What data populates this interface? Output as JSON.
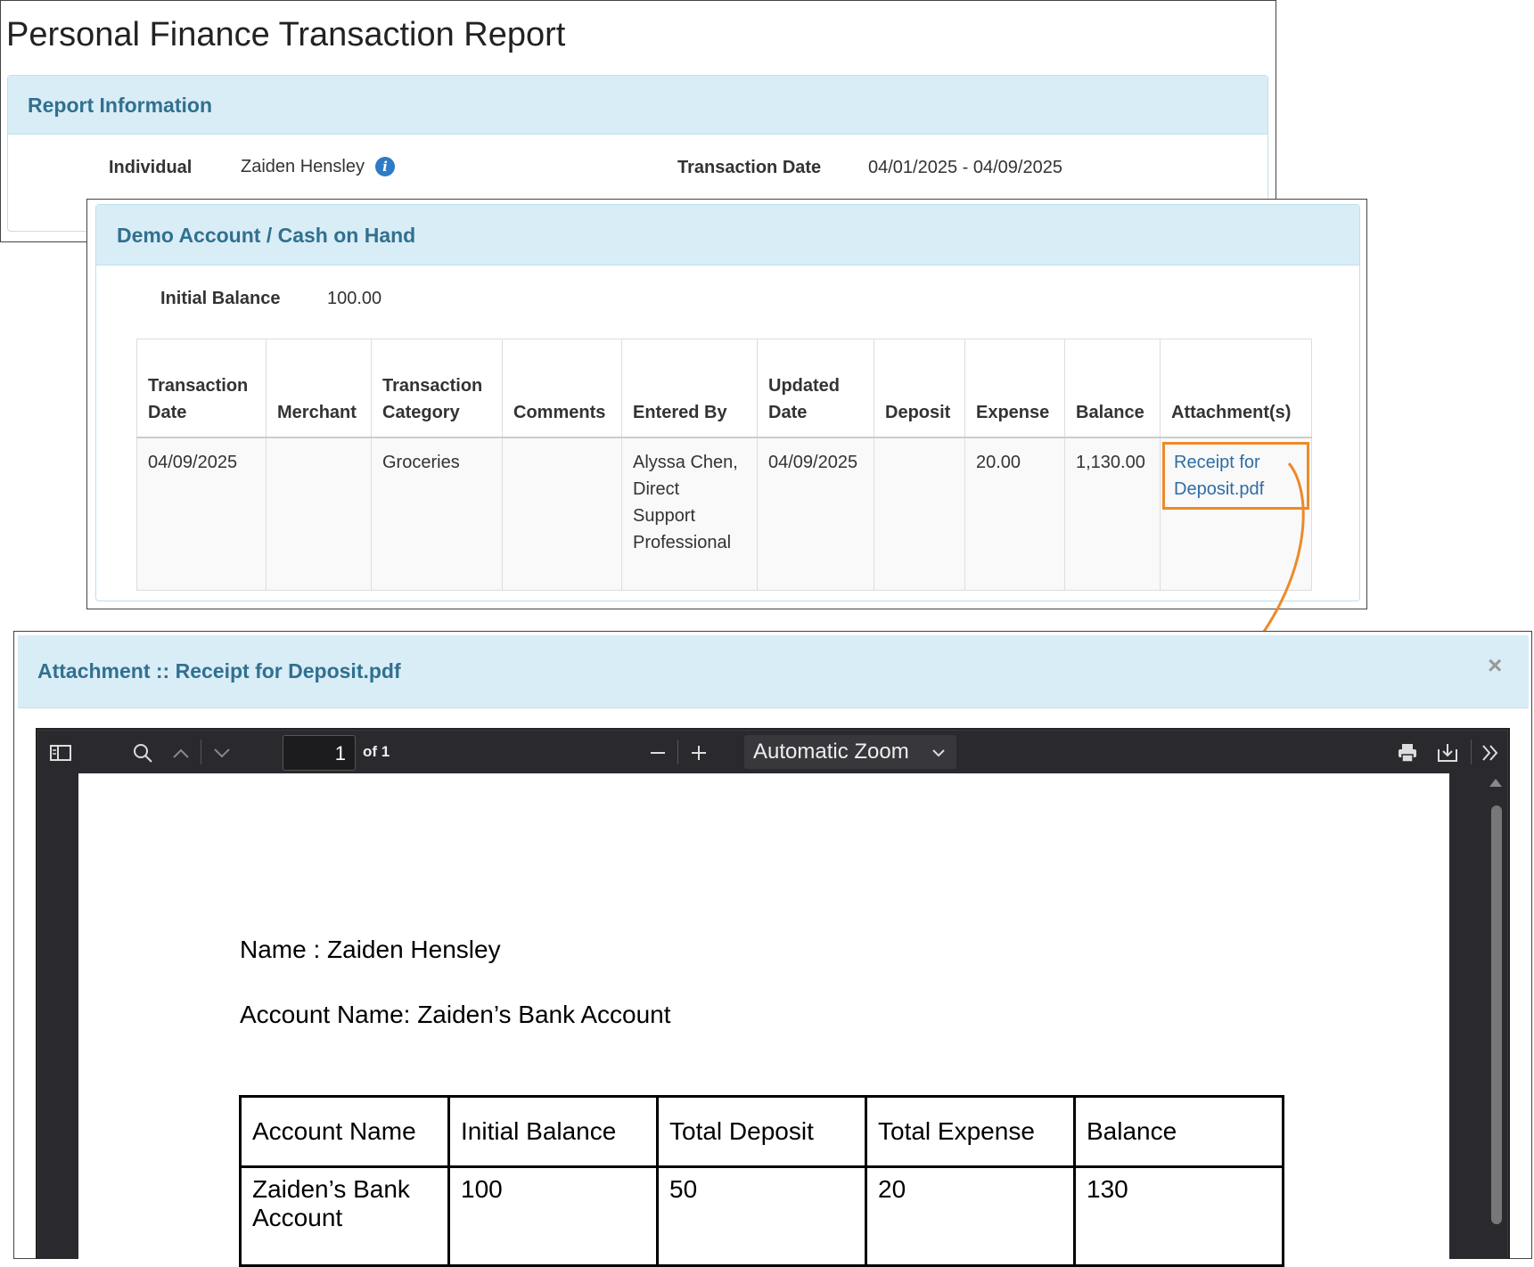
{
  "report": {
    "title": "Personal Finance Transaction Report",
    "info_panel_title": "Report Information",
    "individual_label": "Individual",
    "individual_value": "Zaiden Hensley",
    "transaction_date_label": "Transaction Date",
    "transaction_date_value": "04/01/2025 - 04/09/2025"
  },
  "account": {
    "panel_title": "Demo Account / Cash on Hand",
    "initial_balance_label": "Initial Balance",
    "initial_balance_value": "100.00",
    "columns": [
      "Transaction Date",
      "Merchant",
      "Transaction Category",
      "Comments",
      "Entered By",
      "Updated Date",
      "Deposit",
      "Expense",
      "Balance",
      "Attachment(s)"
    ],
    "rows": [
      {
        "transaction_date": "04/09/2025",
        "merchant": "",
        "category": "Groceries",
        "comments": "",
        "entered_by": "Alyssa Chen, Direct Support Professional",
        "updated_date": "04/09/2025",
        "deposit": "",
        "expense": "20.00",
        "balance": "1,130.00",
        "attachment": "Receipt for Deposit.pdf"
      }
    ]
  },
  "attachment_modal": {
    "title": "Attachment :: Receipt for Deposit.pdf",
    "close_glyph": "×",
    "viewer": {
      "page_number": "1",
      "page_total": "of 1",
      "zoom": "Automatic Zoom"
    },
    "document": {
      "name_line": "Name : Zaiden Hensley",
      "account_line": "Account Name: Zaiden’s Bank Account",
      "table_headers": [
        "Account Name",
        "Initial Balance",
        "Total Deposit",
        "Total Expense",
        "Balance"
      ],
      "table_row": [
        "Zaiden’s Bank Account",
        "100",
        "50",
        "20",
        "130"
      ]
    }
  },
  "colors": {
    "panel_header_bg": "#d9edf7",
    "panel_header_text": "#31708f",
    "link": "#2e6da4",
    "highlight": "#ec8a2b",
    "viewer_toolbar": "#2a2a2e"
  }
}
